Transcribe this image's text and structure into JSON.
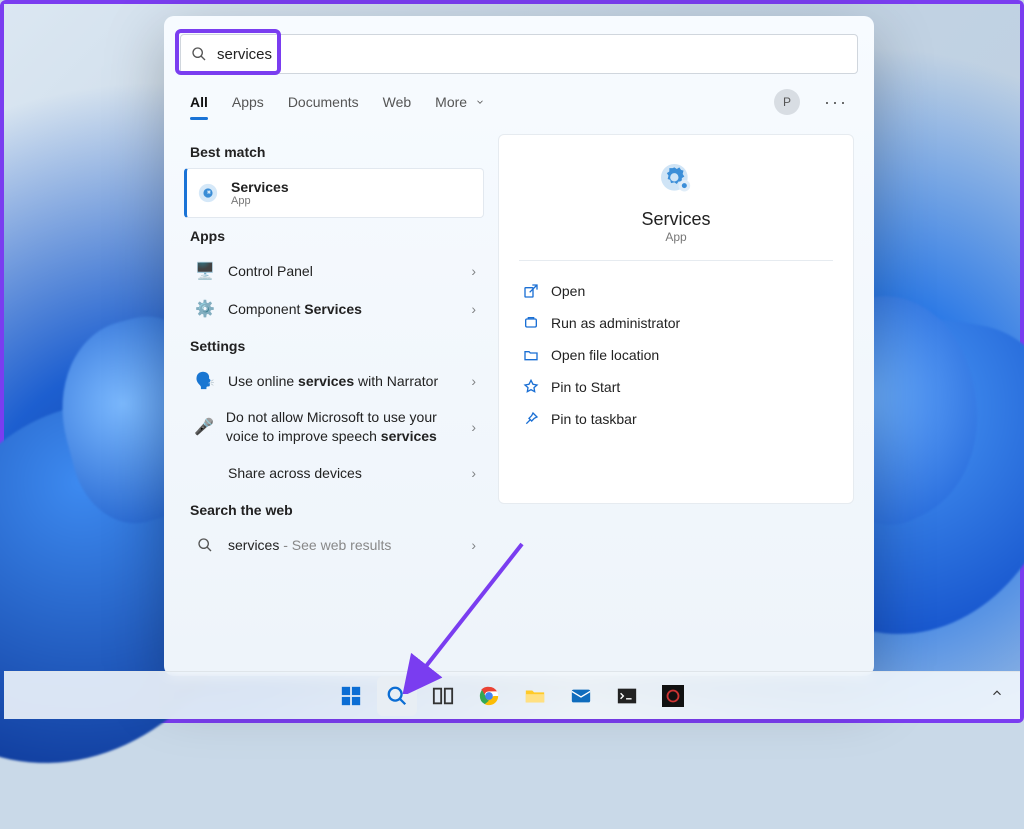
{
  "search": {
    "value": "services"
  },
  "tabs": {
    "items": [
      "All",
      "Apps",
      "Documents",
      "Web",
      "More"
    ],
    "active": 0,
    "avatar_letter": "P"
  },
  "sections": {
    "best_match_label": "Best match",
    "best_match": {
      "title": "Services",
      "subtitle": "App"
    },
    "apps_label": "Apps",
    "apps": [
      {
        "label": "Control Panel"
      },
      {
        "label_pre": "Component ",
        "label_bold": "Services"
      }
    ],
    "settings_label": "Settings",
    "settings": [
      {
        "label_pre": "Use online ",
        "label_bold": "services",
        "label_post": " with Narrator"
      },
      {
        "label_pre": "Do not allow Microsoft to use your voice to improve speech ",
        "label_bold": "services",
        "label_post": ""
      },
      {
        "label_pre": "Share across devices",
        "label_bold": "",
        "label_post": ""
      }
    ],
    "web_label": "Search the web",
    "web": {
      "query": "services",
      "suffix": " - See web results"
    }
  },
  "detail": {
    "title": "Services",
    "subtitle": "App",
    "actions": [
      "Open",
      "Run as administrator",
      "Open file location",
      "Pin to Start",
      "Pin to taskbar"
    ]
  },
  "taskbar": {
    "items": [
      "start",
      "search",
      "taskview",
      "chrome",
      "explorer",
      "mail",
      "terminal",
      "obs"
    ]
  }
}
